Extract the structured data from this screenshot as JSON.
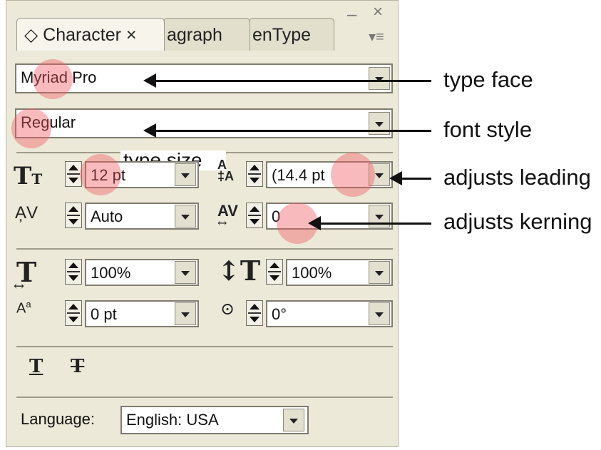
{
  "panel": {
    "tabs": [
      {
        "label": "◇ Character ×",
        "active": true
      },
      {
        "label": "agraph",
        "active": false
      },
      {
        "label": "enType",
        "active": false
      }
    ],
    "controls": {
      "minimize": "–",
      "close": "×",
      "menu": "▾≡"
    }
  },
  "font_family": {
    "value": "Myriad Pro"
  },
  "font_style": {
    "value": "Regular"
  },
  "type_size_label": "type size",
  "size": {
    "value": "12 pt"
  },
  "leading": {
    "value": "(14.4 pt"
  },
  "kerning": {
    "value": "Auto"
  },
  "tracking": {
    "value": "0"
  },
  "vertical_scale": {
    "value": "100%"
  },
  "horizontal_scale": {
    "value": "100%"
  },
  "baseline_shift": {
    "value": "0 pt"
  },
  "rotation": {
    "value": "0°"
  },
  "language": {
    "label": "Language:",
    "value": "English: USA"
  },
  "annotations": {
    "typeface": "type face",
    "fontstyle": "font style",
    "leading": "adjusts leading",
    "kerning": "adjusts kerning"
  },
  "colors": {
    "highlight": "#f05a64",
    "panel_bg": "#ece9d8"
  }
}
